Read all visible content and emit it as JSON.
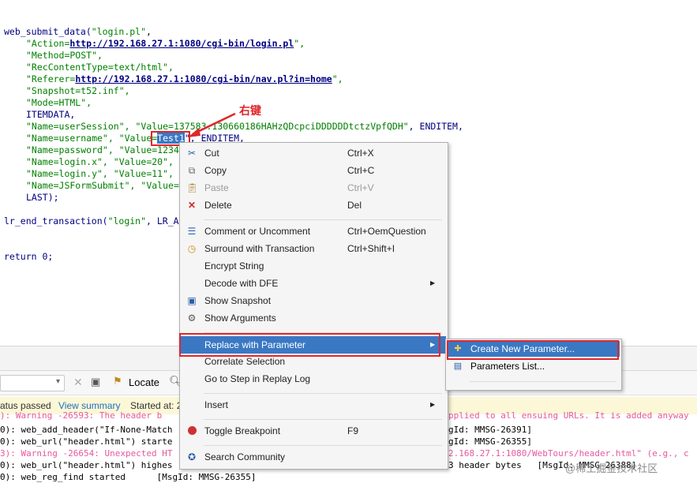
{
  "code": {
    "l1_fn": "web_submit_data(",
    "l1_str": "\"login.pl\"",
    "l1_end": ",",
    "action_pre": "\"Action=",
    "action_url": "http://192.168.27.1:1080/cgi-bin/login.pl",
    "action_post": "\",",
    "method": "\"Method=POST\",",
    "recctype": "\"RecContentType=text/html\",",
    "referer_pre": "\"Referer=",
    "referer_url": "http://192.168.27.1:1080/cgi-bin/nav.pl?in=home",
    "referer_post": "\",",
    "snapshot": "\"Snapshot=t52.inf\",",
    "mode": "\"Mode=HTML\",",
    "itemdata": "ITEMDATA,",
    "session_a": "\"Name=userSession\", ",
    "session_b": "\"Value=137583.130660186HAHzQDcpciDDDDDDtctzVpfQDH\"",
    "session_c": ", ENDITEM,",
    "user_a": "\"Name=username\", ",
    "user_b": "\"Value=",
    "user_sel": "Test1",
    "user_c": "\", ENDITEM,",
    "pass_a": "\"Name=password\", ",
    "pass_b": "\"Value=1234",
    "loginx_a": "\"Name=login.x\", ",
    "loginx_b": "\"Value=20\",",
    "loginy_a": "\"Name=login.y\", ",
    "loginy_b": "\"Value=11\",",
    "jsf_a": "\"Name=JSFormSubmit\", ",
    "jsf_b": "\"Value=",
    "last": "LAST);",
    "end_fn": "lr_end_transaction(",
    "end_str": "\"login\"",
    "end_rest": ", LR_A",
    "ret": "return 0;"
  },
  "annotation": "右键",
  "context_menu": {
    "items": [
      {
        "label": "Cut",
        "shortcut": "Ctrl+X"
      },
      {
        "label": "Copy",
        "shortcut": "Ctrl+C"
      },
      {
        "label": "Paste",
        "shortcut": "Ctrl+V"
      },
      {
        "label": "Delete",
        "shortcut": "Del"
      },
      {
        "label": "Comment or Uncomment",
        "shortcut": "Ctrl+OemQuestion"
      },
      {
        "label": "Surround with Transaction",
        "shortcut": "Ctrl+Shift+I"
      },
      {
        "label": "Encrypt String",
        "shortcut": ""
      },
      {
        "label": "Decode with DFE",
        "shortcut": ""
      },
      {
        "label": "Show Snapshot",
        "shortcut": ""
      },
      {
        "label": "Show Arguments",
        "shortcut": ""
      },
      {
        "label": "Replace with Parameter",
        "shortcut": ""
      },
      {
        "label": "Correlate Selection",
        "shortcut": ""
      },
      {
        "label": "Go to Step in Replay Log",
        "shortcut": ""
      },
      {
        "label": "Insert",
        "shortcut": ""
      },
      {
        "label": "Toggle Breakpoint",
        "shortcut": "F9"
      },
      {
        "label": "Search Community",
        "shortcut": ""
      }
    ]
  },
  "submenu": {
    "items": [
      {
        "label": "Create New Parameter..."
      },
      {
        "label": "Parameters List..."
      }
    ]
  },
  "toolbar": {
    "locate": "Locate"
  },
  "status": {
    "passed": "atus passed",
    "view_summary": "View summary",
    "started": "Started at: 2"
  },
  "log": {
    "l1": "): Warning -26593: The header b",
    "l1b": "pplied to all ensuing URLs. It is added anyway",
    "l2": "0): web_add_header(\"If-None-Match",
    "l2b": "gId: MMSG-26391]",
    "l3": "0): web_url(\"header.html\") starte",
    "l3b": "gId: MMSG-26355]",
    "l4": "3): Warning -26654: Unexpected HT",
    "l4b": "2.168.27.1:1080/WebTours/header.html\" (e.g., c",
    "l5": "0): web_url(\"header.html\") highes",
    "l5b": "3 header bytes   [MsgId: MMSG-26388]",
    "l6": "0): web_reg_find started      [MsgId: MMSG-26355]"
  },
  "watermark": "@稀土掘金技术社区",
  "colors": {
    "highlight": "#3a78c4",
    "annotation_red": "#e0262a",
    "string_green": "#008000",
    "keyword_navy": "#000080",
    "warning_pink": "#e6589f"
  }
}
